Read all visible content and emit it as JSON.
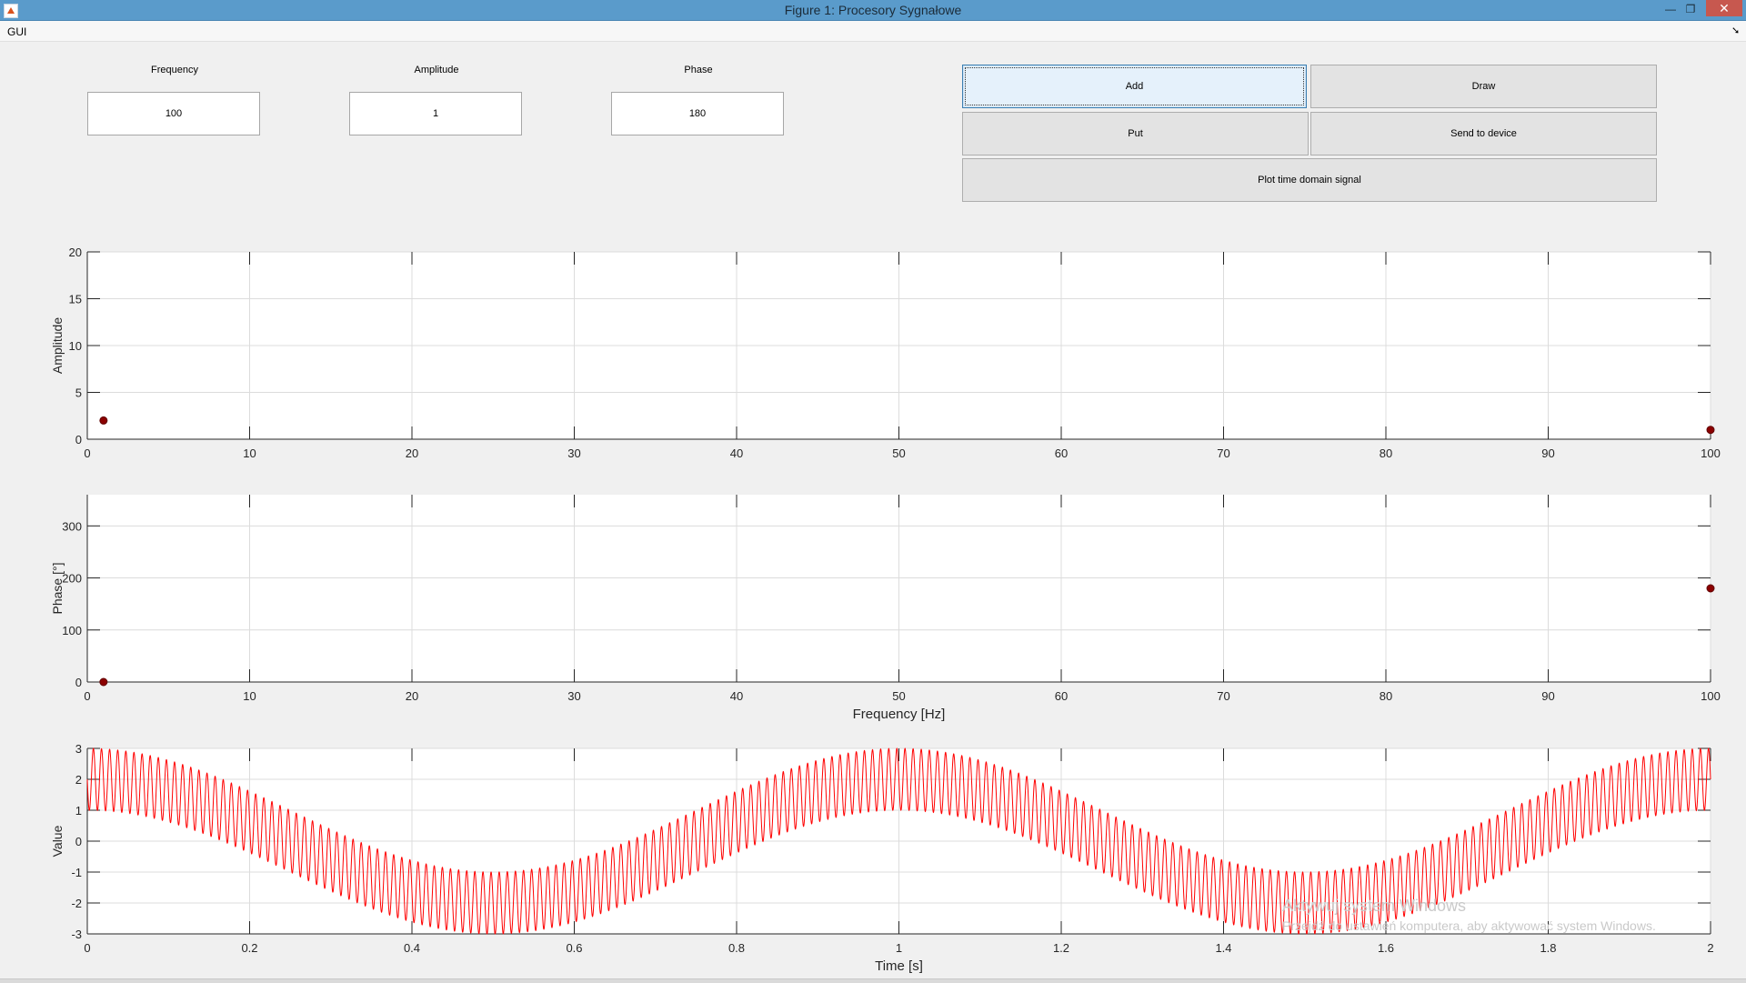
{
  "window": {
    "title": "Figure 1: Procesory Sygnałowe"
  },
  "menu": {
    "gui": "GUI"
  },
  "inputs": {
    "frequency": {
      "label": "Frequency",
      "value": "100"
    },
    "amplitude": {
      "label": "Amplitude",
      "value": "1"
    },
    "phase": {
      "label": "Phase",
      "value": "180"
    }
  },
  "buttons": {
    "add": "Add",
    "draw": "Draw",
    "put": "Put",
    "send": "Send to device",
    "plot": "Plot time domain signal"
  },
  "chart_data": [
    {
      "type": "scatter",
      "ylabel": "Amplitude",
      "xlabel": "",
      "xlim": [
        0,
        100
      ],
      "ylim": [
        0,
        20
      ],
      "x_ticks": [
        0,
        10,
        20,
        30,
        40,
        50,
        60,
        70,
        80,
        90,
        100
      ],
      "y_ticks": [
        0,
        5,
        10,
        15,
        20
      ],
      "grid": true,
      "points": [
        {
          "x": 1,
          "y": 2
        },
        {
          "x": 100,
          "y": 1
        }
      ],
      "color": "#8b0000"
    },
    {
      "type": "scatter",
      "ylabel": "Phase [°]",
      "xlabel": "Frequency [Hz]",
      "xlim": [
        0,
        100
      ],
      "ylim": [
        0,
        360
      ],
      "x_ticks": [
        0,
        10,
        20,
        30,
        40,
        50,
        60,
        70,
        80,
        90,
        100
      ],
      "y_ticks": [
        0,
        100,
        200,
        300
      ],
      "grid": true,
      "points": [
        {
          "x": 1,
          "y": 0
        },
        {
          "x": 100,
          "y": 180
        }
      ],
      "color": "#8b0000"
    },
    {
      "type": "line",
      "ylabel": "Value",
      "xlabel": "Time [s]",
      "xlim": [
        0,
        2
      ],
      "ylim": [
        -3,
        3
      ],
      "x_ticks": [
        0,
        0.2,
        0.4,
        0.6,
        0.8,
        1,
        1.2,
        1.4,
        1.6,
        1.8,
        2
      ],
      "y_ticks": [
        -3,
        -2,
        -1,
        0,
        1,
        2,
        3
      ],
      "grid": true,
      "series": [
        {
          "components": [
            {
              "frequency": 1,
              "amplitude": 2,
              "phase_deg": 90
            },
            {
              "frequency": 100,
              "amplitude": 1,
              "phase_deg": 180
            }
          ]
        }
      ],
      "color": "#ff0000"
    }
  ],
  "watermark": {
    "line1": "Aktywuj system Windows",
    "line2": "Przejdź do ustawień komputera, aby aktywować system Windows."
  }
}
